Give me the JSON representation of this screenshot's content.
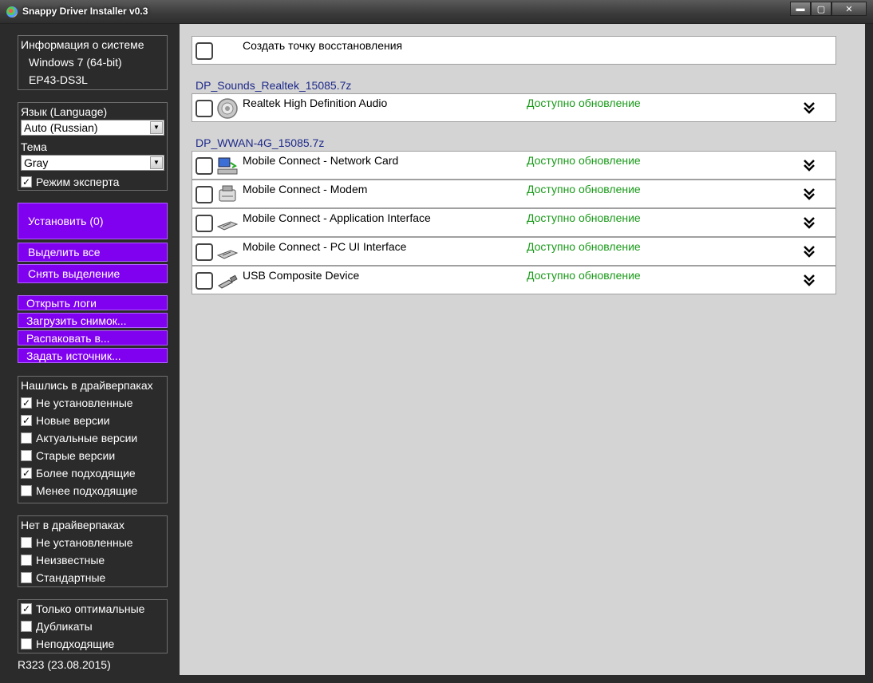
{
  "window": {
    "title": "Snappy Driver Installer v0.3",
    "controls": {
      "minimize": "▬",
      "maximize": "▢",
      "close": "✕"
    }
  },
  "sidebar": {
    "sysinfo": {
      "heading": "Информация о системе",
      "os": "Windows 7 (64-bit)",
      "board": "EP43-DS3L"
    },
    "settings": {
      "language_label": "Язык (Language)",
      "language_value": "Auto (Russian)",
      "theme_label": "Тема",
      "theme_value": "Gray",
      "expert_mode_label": "Режим эксперта",
      "expert_mode_checked": true
    },
    "actions": {
      "install": "Установить (0)",
      "select_all": "Выделить все",
      "deselect": "Снять выделение",
      "open_logs": "Открыть логи",
      "load_snapshot": "Загрузить снимок...",
      "extract_to": "Распаковать в...",
      "set_source": "Задать источник..."
    },
    "found_filters": {
      "heading": "Нашлись в драйверпаках",
      "items": [
        {
          "label": "Не установленные",
          "checked": true
        },
        {
          "label": "Новые версии",
          "checked": true
        },
        {
          "label": "Актуальные версии",
          "checked": false
        },
        {
          "label": "Старые версии",
          "checked": false
        },
        {
          "label": "Более подходящие",
          "checked": true
        },
        {
          "label": "Менее подходящие",
          "checked": false
        }
      ]
    },
    "missing_filters": {
      "heading": "Нет в драйверпаках",
      "items": [
        {
          "label": "Не установленные",
          "checked": false
        },
        {
          "label": "Неизвестные",
          "checked": false
        },
        {
          "label": "Стандартные",
          "checked": false
        }
      ]
    },
    "other_filters": {
      "items": [
        {
          "label": "Только оптимальные",
          "checked": true
        },
        {
          "label": "Дубликаты",
          "checked": false
        },
        {
          "label": "Неподходящие",
          "checked": false
        }
      ]
    },
    "version": "R323 (23.08.2015)"
  },
  "main": {
    "restore_point": "Создать точку восстановления",
    "packs": [
      {
        "name": "DP_Sounds_Realtek_15085.7z",
        "devices": [
          {
            "name": "Realtek High Definition Audio",
            "status": "Доступно обновление",
            "icon": "speaker-icon"
          }
        ]
      },
      {
        "name": "DP_WWAN-4G_15085.7z",
        "devices": [
          {
            "name": "Mobile Connect - Network Card",
            "status": "Доступно обновление",
            "icon": "network-card-icon"
          },
          {
            "name": "Mobile Connect - Modem",
            "status": "Доступно обновление",
            "icon": "modem-icon"
          },
          {
            "name": "Mobile Connect - Application Interface",
            "status": "Доступно обновление",
            "icon": "port-icon"
          },
          {
            "name": "Mobile Connect - PC UI Interface",
            "status": "Доступно обновление",
            "icon": "port-icon"
          },
          {
            "name": "USB Composite Device",
            "status": "Доступно обновление",
            "icon": "usb-icon"
          }
        ]
      }
    ]
  },
  "colors": {
    "sidebar_bg": "#2b2b2b",
    "main_bg": "#d4d4d4",
    "button_purple": "#8000f0",
    "status_green": "#1a9a1a",
    "pack_title": "#1e2a8a"
  }
}
